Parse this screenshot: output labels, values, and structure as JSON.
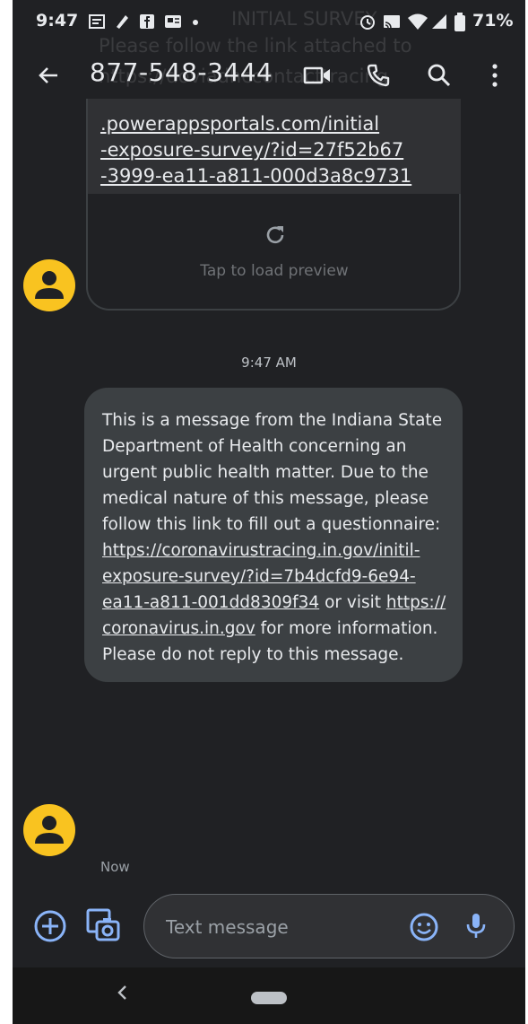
{
  "status_bar": {
    "time": "9:47",
    "battery": "71%"
  },
  "app_bar": {
    "contact_number": "877-548-3444"
  },
  "ghost_text": {
    "line1": "INITIAL SURVEY",
    "line2": "Please follow the link attached to",
    "line3": "https://doviadhccontacttracing"
  },
  "message1": {
    "link_lines": [
      ".powerappsportals.com/initial",
      "-exposure-survey/?id=27f52b67",
      "-3999-ea11-a811-000d3a8c9731"
    ],
    "preview_label": "Tap to load preview"
  },
  "timestamp": "9:47 AM",
  "message2": {
    "line1": "This is a message from the Indiana State",
    "line2": "Department of Health concerning an",
    "line3": "urgent public health matter.  Due to the",
    "line4": "medical nature of this message, please",
    "line5": "follow this link to fill out a questionnaire:",
    "line6_link": "https://coronavirustracing.in.gov/initil-",
    "line7_link": "exposure-survey/?id=7b4dcfd9-6e94-",
    "line8_link": "ea11-a811-001dd8309f34",
    "line8_text": " or visit ",
    "line8_link2": "https://",
    "line9_link": "coronavirus.in.gov",
    "line9_text": " for more information.",
    "line10": "Please do not reply to this message."
  },
  "now_label": "Now",
  "compose": {
    "placeholder": "Text message"
  },
  "colors": {
    "background": "#202124",
    "bubble": "#3c4043",
    "avatar": "#f9c320",
    "accent": "#8ab4f8"
  }
}
